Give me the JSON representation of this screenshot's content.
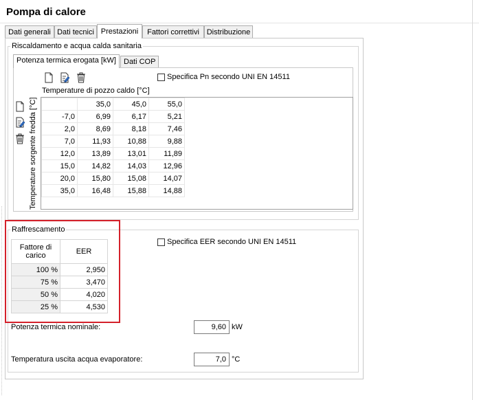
{
  "title": "Pompa di calore",
  "tabs": [
    "Dati generali",
    "Dati tecnici",
    "Prestazioni",
    "Fattori correttivi",
    "Distribuzione"
  ],
  "heating": {
    "group_title": "Riscaldamento e acqua calda sanitaria",
    "tabs": [
      "Potenza termica erogata [kW]",
      "Dati COP"
    ],
    "checkbox_label": "Specifica Pn secondo UNI EN 14511",
    "col_header": "Temperature di pozzo caldo [°C]",
    "row_header": "Temperature sorgente fredda [°C]",
    "columns": [
      "35,0",
      "45,0",
      "55,0"
    ],
    "rows": [
      {
        "t": "-7,0",
        "v": [
          "6,99",
          "6,17",
          "5,21"
        ]
      },
      {
        "t": "2,0",
        "v": [
          "8,69",
          "8,18",
          "7,46"
        ]
      },
      {
        "t": "7,0",
        "v": [
          "11,93",
          "10,88",
          "9,88"
        ]
      },
      {
        "t": "12,0",
        "v": [
          "13,89",
          "13,01",
          "11,89"
        ]
      },
      {
        "t": "15,0",
        "v": [
          "14,82",
          "14,03",
          "12,96"
        ]
      },
      {
        "t": "20,0",
        "v": [
          "15,80",
          "15,08",
          "14,07"
        ]
      },
      {
        "t": "35,0",
        "v": [
          "16,48",
          "15,88",
          "14,88"
        ]
      }
    ]
  },
  "cooling": {
    "group_title": "Raffrescamento",
    "checkbox_label": "Specifica EER secondo UNI EN 14511",
    "col_fattore": "Fattore di carico",
    "col_eer": "EER",
    "rows": [
      {
        "f": "100 %",
        "e": "2,950"
      },
      {
        "f": "75 %",
        "e": "3,470"
      },
      {
        "f": "50 %",
        "e": "4,020"
      },
      {
        "f": "25 %",
        "e": "4,530"
      }
    ],
    "nominal_label": "Potenza termica nominale:",
    "nominal_value": "9,60",
    "nominal_unit": "kW",
    "temp_label": "Temperatura uscita acqua evaporatore:",
    "temp_value": "7,0",
    "temp_unit": "°C"
  },
  "colors": {
    "highlight": "#d4202a"
  }
}
